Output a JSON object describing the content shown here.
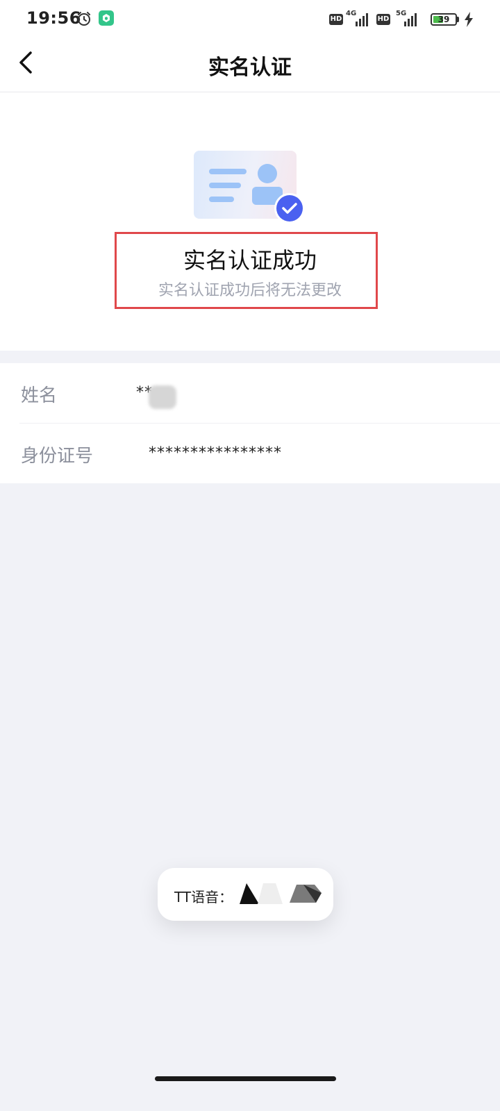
{
  "status_bar": {
    "time": "19:56",
    "hd_label": "HD",
    "net1": "4G",
    "net2": "5G",
    "battery_level": "39"
  },
  "nav": {
    "title": "实名认证"
  },
  "hero": {
    "title": "实名认证成功",
    "subtitle": "实名认证成功后将无法更改"
  },
  "info": {
    "rows": [
      {
        "label": "姓名",
        "value": "**"
      },
      {
        "label": "身份证号",
        "value": "****************"
      }
    ]
  },
  "toast": {
    "label": "TT语音："
  },
  "colors": {
    "accent": "#4a61f0",
    "highlight": "#e0484b",
    "page_bg": "#f1f2f7"
  }
}
